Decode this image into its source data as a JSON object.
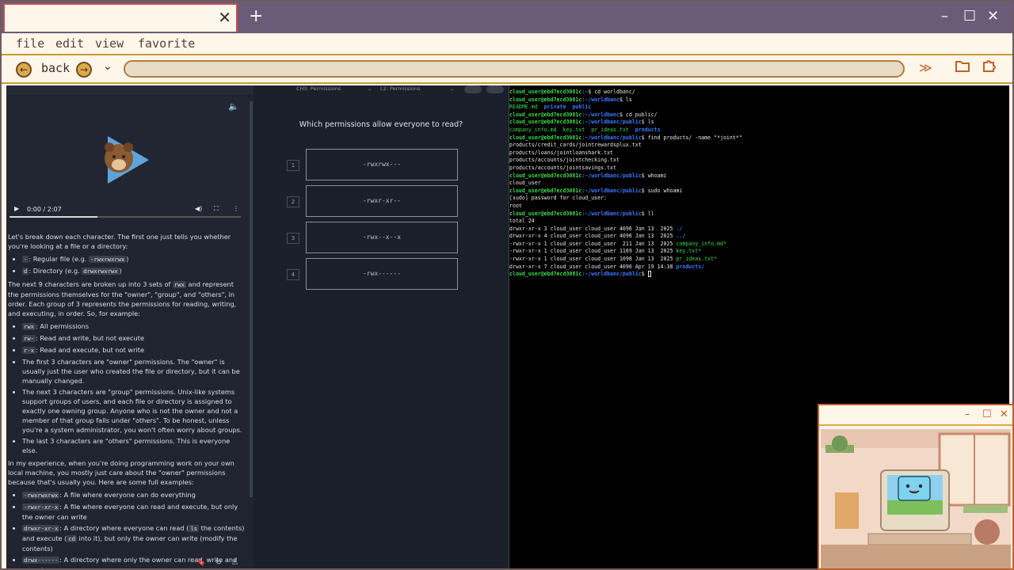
{
  "window": {
    "new_tab_symbol": "+",
    "tab_close_symbol": "✕",
    "minimize_symbol": "–",
    "maximize_symbol": "☐",
    "close_symbol": "✕"
  },
  "menu": {
    "file": "file",
    "edit": "edit",
    "view": "view",
    "favorite": "favorite"
  },
  "nav": {
    "back_label": "back",
    "back_symbol": "←",
    "forward_symbol": "→",
    "dropdown_symbol": "⌄",
    "more_symbol": "≫",
    "folder_icon": "folder-icon",
    "extension_icon": "puzzle-icon",
    "url": ""
  },
  "video": {
    "time": "0:00 / 2:07",
    "progress": 0.38
  },
  "article": {
    "p1": "Let's break down each character. The first one just tells you whether you're looking at a file or a directory:",
    "file_dash": "-",
    "file_label": ": Regular file (e.g.",
    "file_example": "-rwxrwxrwx",
    "dir_d": "d",
    "dir_label": ": Directory (e.g.",
    "dir_example": "drwxrwxrwx",
    "p2a": "The next 9 characters are broken up into 3 sets of",
    "p2code": "rwx",
    "p2b": "and represent the permissions themselves for the \"owner\", \"group\", and \"others\", in order. Each group of 3 represents the permissions for reading, writing, and executing, in order. So, for example:",
    "rwx": "rwx",
    "rwx_desc": ": All permissions",
    "rw": "rw-",
    "rw_desc": ": Read and write, but not execute",
    "rx": "r-x",
    "rx_desc": ": Read and execute, but not write",
    "owner": "The first 3 characters are \"owner\" permissions. The \"owner\" is usually just the user who created the file or directory, but it can be manually changed.",
    "group": "The next 3 characters are \"group\" permissions. Unix-like systems support groups of users, and each file or directory is assigned to exactly one owning group. Anyone who is not the owner and not a member of that group falls under \"others\". To be honest, unless you're a system administrator, you won't often worry about groups.",
    "others": "The last 3 characters are \"others\" permissions. This is everyone else.",
    "p3": "In my experience, when you're doing programming work on your own local machine, you mostly just care about the \"owner\" permissions because that's usually you. Here are some full examples:",
    "ex1": "-rwxrwxrwx",
    "ex1_desc": ": A file where everyone can do everything",
    "ex2": "-rwxr-xr-x",
    "ex2_desc": ": A file where everyone can read and execute, but only the owner can write",
    "ex3": "drwxr-xr-x",
    "ex3_a": ": A directory where everyone can read (",
    "ex3_ls": "ls",
    "ex3_b": " the contents) and execute (",
    "ex3_cd": "cd",
    "ex3_c": " into it), but only the owner can write (modify the contents)",
    "ex4": "drwx------",
    "ex4_desc": ": A directory where only the owner can read, write and execute"
  },
  "quiz": {
    "chapter": "CH3: Permissions",
    "lesson": "L2: Permissions",
    "question": "Which permissions allow everyone to read?",
    "options": [
      {
        "num": "1",
        "text": "-rwxrwx---"
      },
      {
        "num": "2",
        "text": "-rwxr-xr--"
      },
      {
        "num": "3",
        "text": "-rwx--x--x"
      },
      {
        "num": "4",
        "text": "-rwx------"
      }
    ]
  },
  "terminal": {
    "prompt_user": "cloud_user@ebd7ecd3081c",
    "home_path": ":~/worldbanc",
    "public_path": ":~/worldbanc/public",
    "cmd_cd": "$ cd worldbanc/",
    "cmd_ls": "$ ls",
    "ls1_readme": "README.md",
    "ls1_private": "private",
    "ls1_public": "public",
    "cmd_cd_public": "$ cd public/",
    "ls2_company": "company_info.md",
    "ls2_key": "key.txt",
    "ls2_ideas": "pr_ideas.txt",
    "ls2_products": "products",
    "cmd_find": "$ find products/ -name \"*joint*\"",
    "find1": "products/credit_cards/jointrewardsplux.txt",
    "find2": "products/loans/jointloanshark.txt",
    "find3": "products/accounts/jointchecking.txt",
    "find4": "products/accounts/jointsavings.txt",
    "cmd_whoami": "$ whoami",
    "whoami_out": "cloud_user",
    "cmd_sudo": "$ sudo whoami",
    "sudo_prompt": "[sudo] password for cloud_user:",
    "sudo_out": "root",
    "cmd_ll": "$ ll",
    "total": "total 24",
    "ll1": "drwxr-xr-x 3 cloud_user cloud_user 4096 Jan 13  2025 ",
    "ll1_name": "./",
    "ll2": "drwxr-xr-x 4 cloud_user cloud_user 4096 Jan 13  2025 ",
    "ll2_name": "../",
    "ll3": "-rwxr-xr-x 1 cloud_user cloud_user  211 Jan 13  2025 ",
    "ll3_name": "company_info.md*",
    "ll4": "-rwxr-xr-x 1 cloud_user cloud_user 1169 Jan 13  2025 ",
    "ll4_name": "key.txt*",
    "ll5": "-rwxr-xr-x 1 cloud_user cloud_user 1098 Jan 13  2025 ",
    "ll5_name": "pr_ideas.txt*",
    "ll6": "drwxr-xr-x 7 cloud_user cloud_user 4096 Apr 19 14:38 ",
    "ll6_name": "products/",
    "final_prompt": "$ "
  },
  "floating_window": {
    "minimize_symbol": "–",
    "maximize_symbol": "☐",
    "close_symbol": "✕"
  }
}
